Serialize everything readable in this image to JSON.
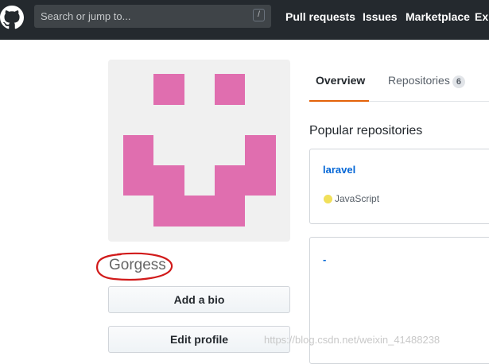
{
  "header": {
    "logo_icon": "github-octocat-icon",
    "search": {
      "placeholder": "Search or jump to...",
      "shortcut": "/"
    },
    "nav": [
      {
        "label": "Pull requests"
      },
      {
        "label": "Issues"
      },
      {
        "label": "Marketplace"
      },
      {
        "label": "Ex"
      }
    ]
  },
  "profile": {
    "avatar": {
      "type": "identicon",
      "color": "#e06eaf"
    },
    "username": "Gorgess",
    "annotation": {
      "type": "hand-drawn-circle",
      "color": "#d11a1a"
    },
    "add_bio_label": "Add a bio",
    "edit_profile_label": "Edit profile"
  },
  "tabs": [
    {
      "label": "Overview",
      "selected": true
    },
    {
      "label": "Repositories",
      "count": "6",
      "selected": false
    }
  ],
  "accent_color": "#e36209",
  "popular": {
    "title": "Popular repositories",
    "repos": [
      {
        "name": "laravel",
        "language": "JavaScript",
        "language_color": "#f1e05a"
      },
      {
        "name": "-"
      }
    ]
  },
  "watermark": "https://blog.csdn.net/weixin_41488238"
}
